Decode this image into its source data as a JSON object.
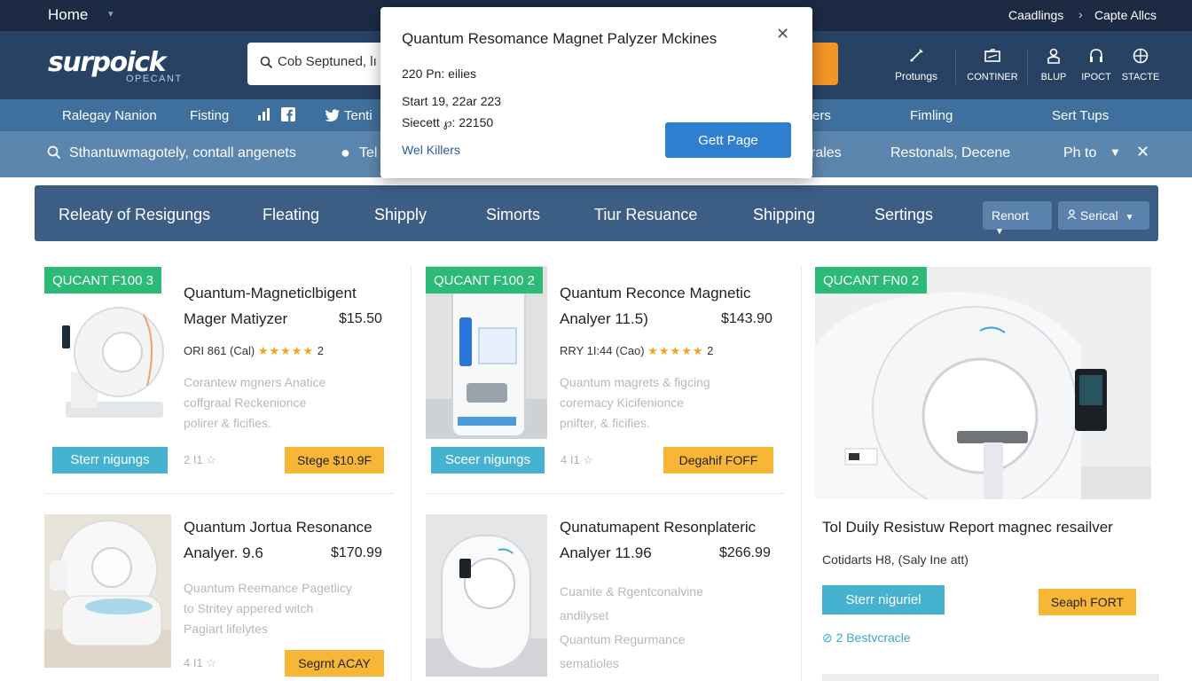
{
  "topbar": {
    "home": "Home",
    "right_link_1": "Caadlings",
    "separator": "›",
    "right_link_2": "Capte Allcs"
  },
  "header": {
    "logo": "surpoick",
    "logo_sub": "OPECANT",
    "search_value": "Cob Septuned, lı",
    "search_button": "ı",
    "icons": [
      {
        "label": "Protungs",
        "icon": "tool-icon"
      },
      {
        "label": "CONTINER",
        "icon": "folder-icon"
      },
      {
        "label": "BLUP",
        "icon": "user-icon"
      },
      {
        "label": "IPOCT",
        "icon": "headset-icon"
      },
      {
        "label": "STACTE",
        "icon": "globe-icon"
      }
    ]
  },
  "nav1": {
    "items": [
      "Ralegay Nanion",
      "Fisting",
      "Tenti",
      "ers",
      "Fimling",
      "Sert Tups"
    ]
  },
  "nav2": {
    "search_text": "Sthantuwmagotely, contall angenets",
    "item_tel": "Tel",
    "item_rales": "rales",
    "item_restonals": "Restonals, Decene",
    "item_photo": "Ph to"
  },
  "categories": {
    "items": [
      "Releaty of Resigungs",
      "Fleating",
      "Shipply",
      "Simorts",
      "Tiur Resuance",
      "Shipping",
      "Sertings"
    ],
    "select1": "Renort",
    "select2": "Serical"
  },
  "products": [
    {
      "tag": "QUCANT F100 3",
      "title_line1": "Quantum-Magneticlbigent",
      "title_line2": "Mager Matiyzer",
      "price": "$15.50",
      "meta": "ORI 861 (Cal)",
      "rating": 5,
      "rating_count": "2",
      "desc": [
        "Corantew mgners Anatice",
        "coffgraal Reckenionce",
        "polirer & ficifies."
      ],
      "btn_primary": "Sterr nigungs",
      "small_note": "2 I1 ☆",
      "btn_secondary": "Stege $10.9F"
    },
    {
      "tag": "QUCANT F100 2",
      "title_line1": "Quantum Reconce Magnetic",
      "title_line2": "Analyer 11.5)",
      "price": "$143.90",
      "meta": "RRY 1I:44 (Cao)",
      "rating": 5,
      "rating_count": "2",
      "desc": [
        "Quantum magrets & figcing",
        "coremacy Kicifenionce",
        "pnifter, & ficifies."
      ],
      "btn_primary": "Sceer nigungs",
      "small_note": "4 I1 ☆",
      "btn_secondary": "Degahif FOFF"
    },
    {
      "tag": "QUCANT FN0 2",
      "title": "Tol Duily Resistuw Report magnec resailver",
      "meta": "Cotidarts H8, (Saly Ine att)",
      "btn_primary": "Sterr niguriel",
      "btn_secondary": "Seaph FORT",
      "link": "2 Bestvcracle"
    },
    {
      "title_line1": "Quantum Jortua Resonance",
      "title_line2": "Analyer. 9.6",
      "price": "$170.99",
      "desc": [
        "Quantum Reemance Pagetlicy",
        "to Stritey appered witch",
        "Pagiart lifelytes"
      ],
      "small_note": "4 I1 ☆",
      "btn_secondary": "Segrnt ACAY"
    },
    {
      "title_line1": "Qunatumapent Resonplateric",
      "title_line2": "Analyer 11.96",
      "price": "$266.99",
      "desc": [
        "Cuanite & Rgentconalvine",
        "andilyset",
        "Quantum Regurmance",
        "sematioles"
      ]
    }
  ],
  "modal": {
    "title": "Quantum Resomance Magnet Palyzer Mckines",
    "line1": "220 Pn: eilies",
    "line2": "Start 19, 22ar 223",
    "line3": "Siecett ℘: 22150",
    "link": "Wel Killers",
    "button": "Gett Page"
  },
  "colors": {
    "topbar": "#1c2a44",
    "header": "#284264",
    "accent_orange": "#f39526",
    "tag_green": "#2bbb76",
    "teal_button": "#45b3cf",
    "star": "#f2a31f"
  }
}
